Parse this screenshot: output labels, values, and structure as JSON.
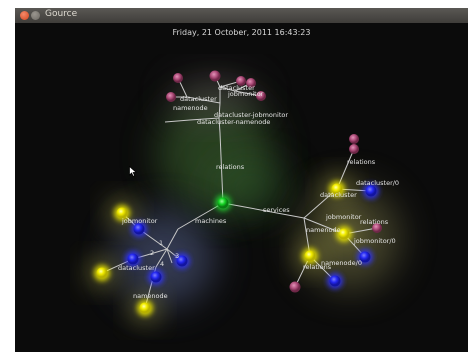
{
  "window": {
    "title": "Gource"
  },
  "overlay": {
    "datetime": "Friday, 21 October, 2011 16:43:23"
  },
  "colors": {
    "pink": "#b8507f",
    "yellow": "#f5f006",
    "blue": "#2a2dff",
    "green": "#1ed12c",
    "edge": "#c9c9c9"
  },
  "labels": {
    "relations_top": "relations",
    "machines": "machines",
    "services": "services",
    "datacluster_a": "datacluster",
    "jobmonitor_a": "jobmonitor",
    "datacluster_b": "datacluster",
    "namenode_a": "namenode",
    "datacluster_jobmonitor": "datacluster-jobmonitor",
    "datacluster_namenode": "datacluster-namenode",
    "jobmonitor_b": "jobmonitor",
    "datacluster_c": "datacluster",
    "namenode_b": "namenode",
    "num_1": "1",
    "num_2": "2",
    "num_3": "3",
    "num_4": "4",
    "relations_r": "relations",
    "datacluster0": "datacluster/0",
    "datacluster_d": "datacluster",
    "jobmonitor_c": "jobmonitor",
    "relations_r2": "relations",
    "namenode_c": "namenode",
    "jobmonitor0": "jobmonitor/0",
    "namenode0": "namenode/0",
    "relations_r3": "relations"
  }
}
